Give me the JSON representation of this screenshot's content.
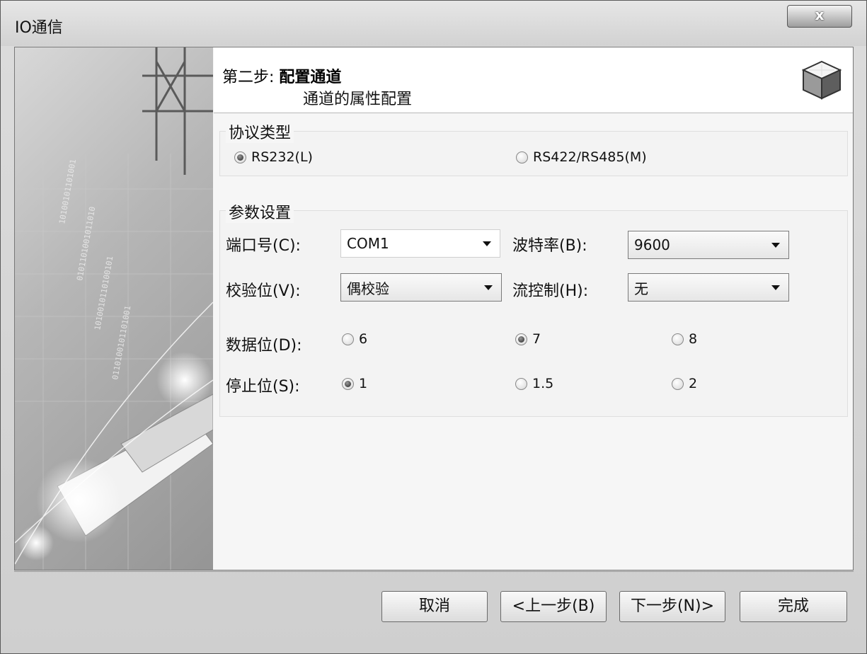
{
  "window": {
    "title": "IO通信",
    "close_label": "x"
  },
  "header": {
    "step_prefix": "第二步:",
    "step_name": "配置通道",
    "subtitle": "通道的属性配置",
    "icon": "cube-icon"
  },
  "protocol": {
    "label": "协议类型",
    "options": [
      {
        "label": "RS232(L)",
        "selected": true
      },
      {
        "label": "RS422/RS485(M)",
        "selected": false
      }
    ]
  },
  "params": {
    "label": "参数设置",
    "port": {
      "label": "端口号(C):",
      "value": "COM1"
    },
    "baud": {
      "label": "波特率(B):",
      "value": "9600"
    },
    "parity": {
      "label": "校验位(V):",
      "value": "偶校验"
    },
    "flow": {
      "label": "流控制(H):",
      "value": "无"
    },
    "data_bits": {
      "label": "数据位(D):",
      "options": [
        {
          "label": "6",
          "selected": false
        },
        {
          "label": "7",
          "selected": true
        },
        {
          "label": "8",
          "selected": false
        }
      ]
    },
    "stop_bits": {
      "label": "停止位(S):",
      "options": [
        {
          "label": "1",
          "selected": true
        },
        {
          "label": "1.5",
          "selected": false
        },
        {
          "label": "2",
          "selected": false
        }
      ]
    }
  },
  "buttons": {
    "cancel": "取消",
    "prev": "<上一步(B)",
    "next": "下一步(N)>",
    "finish": "完成"
  }
}
